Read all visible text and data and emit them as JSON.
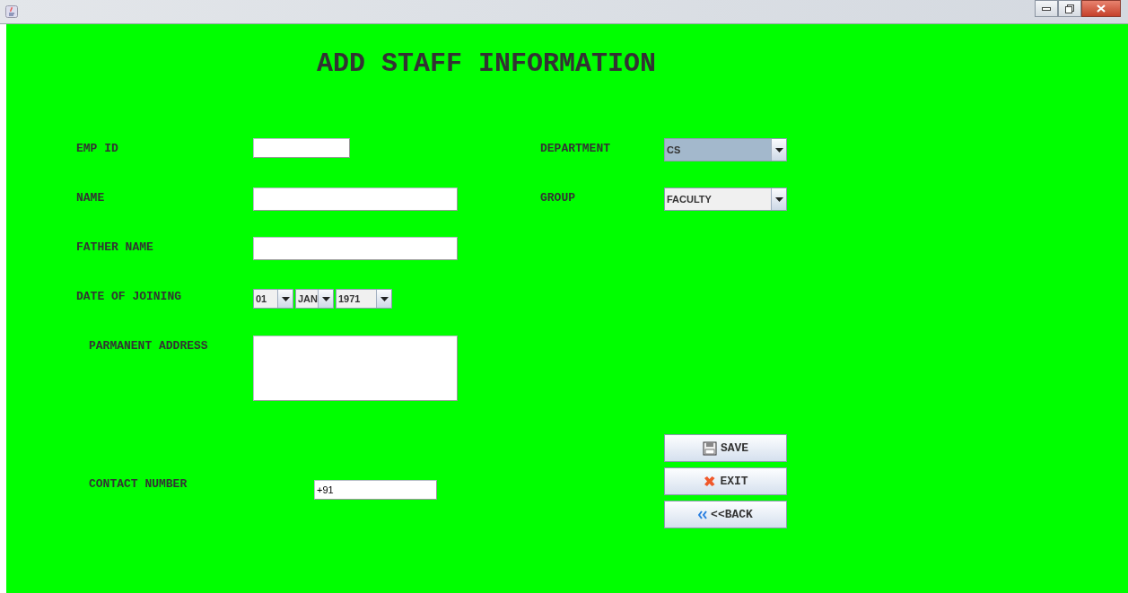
{
  "title": "ADD STAFF INFORMATION",
  "left_fields": [
    {
      "label": "EMP ID",
      "kind": "short"
    },
    {
      "label": "NAME",
      "kind": "text"
    },
    {
      "label": "FATHER NAME",
      "kind": "text"
    },
    {
      "label": "DATE OF JOINING",
      "kind": "date",
      "parts": [
        {
          "value": "01"
        },
        {
          "value": "JAN"
        },
        {
          "value": "1971"
        }
      ]
    },
    {
      "label": "PARMANENT ADDRESS",
      "kind": "area"
    }
  ],
  "right_fields": [
    {
      "label": "DEPARTMENT",
      "value": "CS",
      "focused": true
    },
    {
      "label": "GROUP",
      "value": "FACULTY",
      "focused": false
    }
  ],
  "contact": {
    "label": "CONTACT NUMBER",
    "value": "+91"
  },
  "buttons": [
    {
      "label": "SAVE",
      "kind": "save"
    },
    {
      "label": "EXIT",
      "kind": "exit"
    },
    {
      "label": "<<BACK",
      "kind": "back"
    }
  ]
}
